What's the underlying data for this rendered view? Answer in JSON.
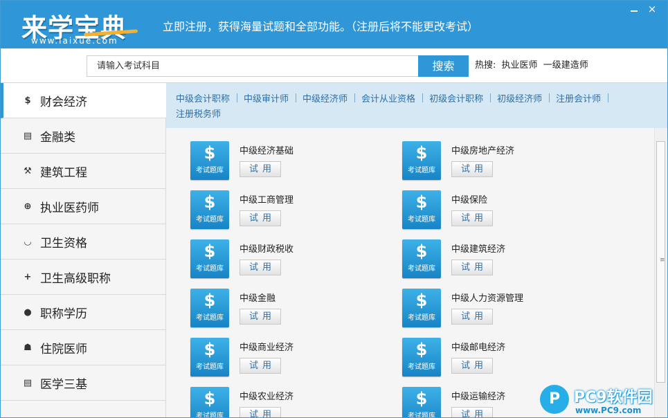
{
  "app": {
    "logo_text": "来学宝典",
    "logo_url": "www.laixue.com",
    "promo_text": "立即注册，获得海量试题和全部功能。（注册后将不能更改考试）",
    "minimize_label": "",
    "close_label": "×"
  },
  "search": {
    "placeholder": "请输入考试科目",
    "button_label": "搜索",
    "hot_label": "热搜:",
    "hot_items": [
      "执业医师",
      "一级建造师"
    ]
  },
  "sidebar": {
    "items": [
      {
        "label": "财会经济",
        "icon": "dollar-icon",
        "glyph": "$",
        "active": true
      },
      {
        "label": "金融类",
        "icon": "clipboard-icon",
        "glyph": "▤",
        "active": false
      },
      {
        "label": "建筑工程",
        "icon": "hammer-icon",
        "glyph": "⚒",
        "active": false
      },
      {
        "label": "执业医药师",
        "icon": "medkit-icon",
        "glyph": "⊕",
        "active": false
      },
      {
        "label": "卫生资格",
        "icon": "bowl-icon",
        "glyph": "◡",
        "active": false
      },
      {
        "label": "卫生高级职称",
        "icon": "plus-icon",
        "glyph": "+",
        "active": false
      },
      {
        "label": "职称学历",
        "icon": "person-icon",
        "glyph": "●",
        "active": false
      },
      {
        "label": "住院医师",
        "icon": "doctor-icon",
        "glyph": "☗",
        "active": false
      },
      {
        "label": "医学三基",
        "icon": "document-icon",
        "glyph": "▤",
        "active": false
      }
    ]
  },
  "subnav": {
    "links": [
      "中级会计职称",
      "中级审计师",
      "中级经济师",
      "会计从业资格",
      "初级会计职称",
      "初级经济师",
      "注册会计师",
      "注册税务师"
    ]
  },
  "exams": {
    "icon_caption": "考试题库",
    "icon_glyph": "$",
    "try_label": "试用",
    "items": [
      {
        "name": "中级经济基础"
      },
      {
        "name": "中级房地产经济"
      },
      {
        "name": "中级工商管理"
      },
      {
        "name": "中级保险"
      },
      {
        "name": "中级财政税收"
      },
      {
        "name": "中级建筑经济"
      },
      {
        "name": "中级金融"
      },
      {
        "name": "中级人力资源管理"
      },
      {
        "name": "中级商业经济"
      },
      {
        "name": "中级邮电经济"
      },
      {
        "name": "中级农业经济"
      },
      {
        "name": "中级运输经济"
      }
    ]
  },
  "watermark": {
    "title": "PC9软件园",
    "url": "www.PC9.com",
    "logo_glyph": "P"
  },
  "colors": {
    "brand_blue": "#2f97d7",
    "subnav_bg": "#d6e8f3",
    "link_blue": "#2a6fad"
  }
}
